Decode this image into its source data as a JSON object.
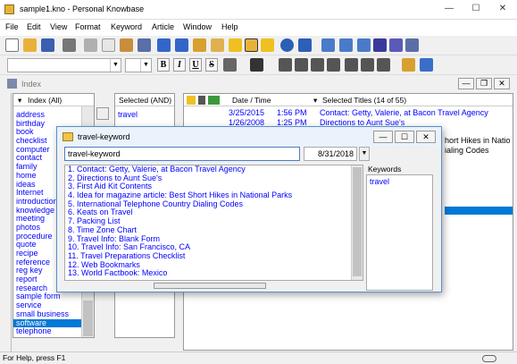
{
  "window": {
    "title": "sample1.kno - Personal Knowbase"
  },
  "menu": [
    "File",
    "Edit",
    "View",
    "Format",
    "Keyword",
    "Article",
    "Window",
    "Help"
  ],
  "index_tab": "Index",
  "index_panel": {
    "header": "Index (All)",
    "items": [
      "address",
      "birthday",
      "book",
      "checklist",
      "computer",
      "contact",
      "family",
      "home",
      "ideas",
      "Internet",
      "introduction",
      "knowledge",
      "meeting",
      "photos",
      "procedure",
      "quote",
      "recipe",
      "reference",
      "reg key",
      "report",
      "research",
      "sample form",
      "service",
      "small business",
      "software",
      "telephone"
    ],
    "selected": "software"
  },
  "selected_panel": {
    "header": "Selected (AND)",
    "items": [
      "travel"
    ]
  },
  "titles_panel": {
    "col_date": "Date / Time",
    "col_titles": "Selected Titles (14 of 55)",
    "rows": [
      {
        "date": "3/25/2015",
        "time": "1:56 PM",
        "title": "Contact: Getty, Valerie, at Bacon Travel Agency"
      },
      {
        "date": "1/26/2008",
        "time": "1:25 PM",
        "title": "Directions to Aunt Sue's"
      }
    ],
    "right_fragments": [
      "hort Hikes in Natio",
      "ialing Codes"
    ]
  },
  "dialog": {
    "title": "travel-keyword",
    "name_value": "travel-keyword",
    "date_value": "8/31/2018",
    "keywords_label": "Keywords",
    "keywords": [
      "travel"
    ],
    "articles": [
      "1. Contact: Getty, Valerie, at Bacon Travel Agency",
      "2. Directions to Aunt Sue's",
      "3. First Aid Kit Contents",
      "4. Idea for magazine article: Best Short Hikes in National Parks",
      "5. International Telephone Country Dialing Codes",
      "6. Keats on Travel",
      "7. Packing List",
      "8. Time Zone Chart",
      "9. Travel Info: Blank Form",
      "10. Travel Info: San Francisco, CA",
      "11. Travel Preparations Checklist",
      "12. Web Bookmarks",
      "13. World Factbook: Mexico"
    ]
  },
  "status": {
    "text": "For Help, press F1"
  }
}
